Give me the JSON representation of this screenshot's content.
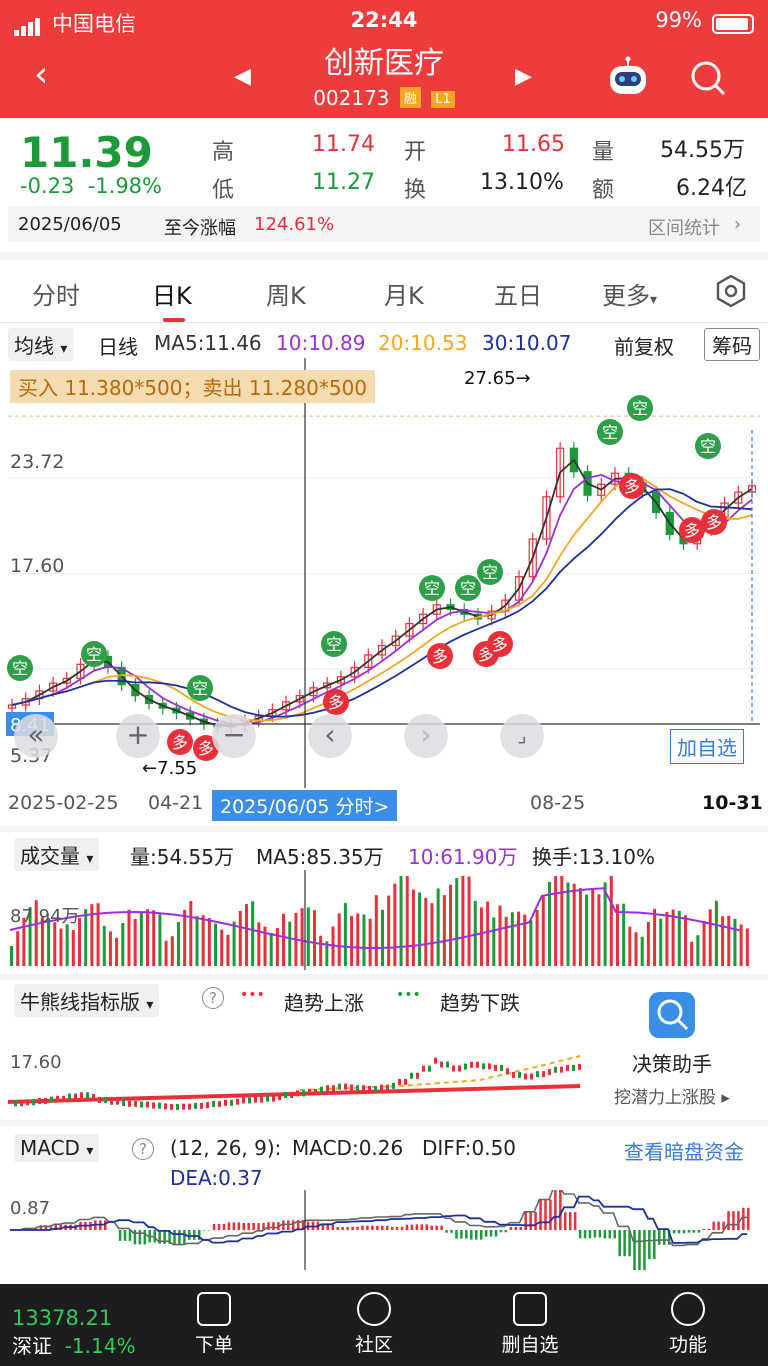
{
  "status": {
    "carrier": "中国电信",
    "time": "22:44",
    "battery": "99%"
  },
  "header": {
    "title": "创新医疗",
    "code": "002173",
    "tag1": "融",
    "tag2": "L1"
  },
  "quote": {
    "price": "11.39",
    "change": "-0.23",
    "change_pct": "-1.98%",
    "high_label": "高",
    "high": "11.74",
    "low_label": "低",
    "low": "11.27",
    "open_label": "开",
    "open": "11.65",
    "turn_label": "换",
    "turn": "13.10%",
    "vol_label": "量",
    "vol": "54.55万",
    "amt_label": "额",
    "amt": "6.24亿",
    "date": "2025/06/05",
    "since_label": "至今涨幅",
    "since": "124.61%",
    "range_stat": "区间统计"
  },
  "tabs": [
    "分时",
    "日K",
    "周K",
    "月K",
    "五日",
    "更多"
  ],
  "ma_row": {
    "dropdown": "均线",
    "period": "日线",
    "ma5": "MA5:11.46",
    "ma10": "10:10.89",
    "ma20": "20:10.53",
    "ma30": "30:10.07",
    "adjust": "前复权",
    "chip": "筹码",
    "colors": {
      "ma5": "#333333",
      "ma10": "#9b30d9",
      "ma20": "#f5a623",
      "ma30": "#1e2f9e"
    }
  },
  "kchart": {
    "trade_info": "买入 11.380*500；卖出 11.280*500",
    "y_labels": [
      "23.72",
      "17.60",
      "5.37"
    ],
    "partial_label": "48",
    "high_marker": "27.65→",
    "low_marker": "←7.55",
    "left_badge": "8.41",
    "add_fav": "加自选",
    "signal_kong": "空",
    "signal_duo": "多"
  },
  "chart_data": {
    "type": "candlestick",
    "x_ticks": [
      "2025-02-25",
      "04-21",
      "08-25",
      "10-31"
    ],
    "highlight_date": "2025/06/05 分时>",
    "ylim": [
      5.37,
      29.0
    ],
    "high": 27.65,
    "low": 7.55,
    "close_series": [
      9.2,
      9.6,
      10.1,
      10.6,
      10.9,
      11.8,
      12.3,
      11.6,
      10.5,
      9.8,
      9.3,
      9.0,
      8.7,
      8.3,
      8.0,
      7.8,
      7.9,
      8.2,
      8.5,
      8.9,
      9.4,
      9.8,
      10.3,
      10.6,
      11.0,
      11.6,
      12.4,
      13.0,
      13.6,
      14.4,
      15.0,
      15.6,
      15.3,
      15.0,
      14.7,
      15.2,
      15.9,
      17.4,
      19.8,
      22.5,
      25.6,
      24.1,
      22.6,
      23.3,
      24.0,
      23.4,
      22.8,
      21.5,
      20.1,
      19.5,
      20.4,
      21.2,
      22.1,
      22.8,
      23.2
    ]
  },
  "volume": {
    "dropdown": "成交量",
    "vol": "量:54.55万",
    "ma5": "MA5:85.35万",
    "ma10": "10:61.90万",
    "turnover": "换手:13.10%",
    "y_label": "87.94万"
  },
  "bullbear": {
    "dropdown": "牛熊线指标版",
    "up_label": "趋势上涨",
    "down_label": "趋势下跌",
    "y_label": "17.60",
    "help": "?"
  },
  "decision": {
    "title": "决策助手",
    "subtitle": "挖潜力上涨股"
  },
  "macd": {
    "dropdown": "MACD",
    "params": "(12, 26, 9):",
    "macd": "MACD:0.26",
    "diff": "DIFF:0.50",
    "dea": "DEA:0.37",
    "link": "查看暗盘资金",
    "y_label": "0.87",
    "help": "?"
  },
  "bottom": {
    "index_value": "13378.21",
    "index_name": "深证",
    "index_change": "-1.14%",
    "items": [
      "下单",
      "社区",
      "删自选",
      "功能"
    ]
  }
}
